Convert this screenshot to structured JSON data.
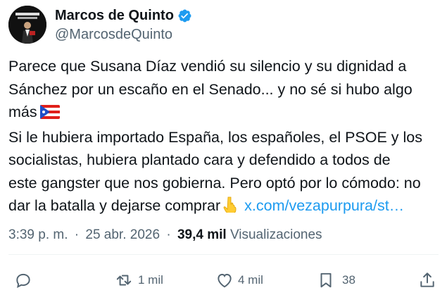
{
  "author": {
    "display_name": "Marcos de Quinto",
    "handle": "@MarcosdeQuinto",
    "verified_icon": "verified-badge-icon"
  },
  "tweet": {
    "lines": [
      "Parece que Susana Díaz vendió su silencio y su dignidad a",
      "Sánchez por un escaño en el Senado... y no sé si hubo algo",
      "más",
      "Si le hubiera importado España, los españoles, el PSOE y los",
      "socialistas, hubiera plantado cara y defendido a todos de",
      "este gangster que nos gobierna. Pero optó por lo cómodo: no",
      "dar la batalla y dejarse comprar"
    ],
    "link_text": "x.com/vezapurpura/st…"
  },
  "meta": {
    "time": "3:39 p. m.",
    "separator": "·",
    "date": "25 abr. 2026",
    "views_count": "39,4 mil",
    "views_label": "Visualizaciones"
  },
  "actions": {
    "reply": {
      "icon": "reply-icon",
      "count": ""
    },
    "retweet": {
      "icon": "retweet-icon",
      "count": "1 mil"
    },
    "like": {
      "icon": "heart-icon",
      "count": "4 mil"
    },
    "bookmark": {
      "icon": "bookmark-icon",
      "count": "38"
    },
    "share": {
      "icon": "share-icon"
    }
  },
  "colors": {
    "text": "#0f1419",
    "secondary": "#536471",
    "link": "#1d9bf0",
    "verified": "#1d9bf0"
  }
}
